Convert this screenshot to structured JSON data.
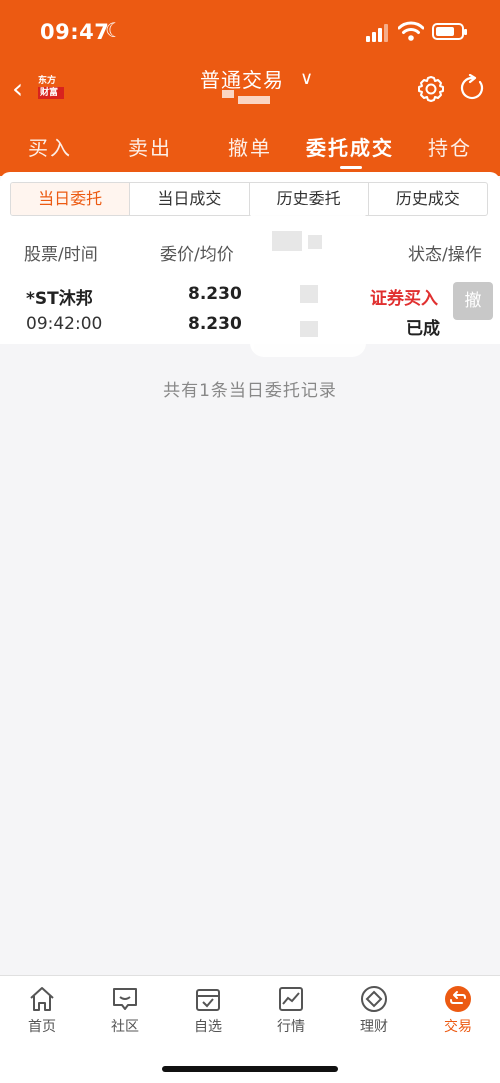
{
  "status_bar": {
    "time": "09:47",
    "moon": "☾"
  },
  "navbar": {
    "logo_line1": "东方",
    "logo_line2": "财富",
    "title": "普通交易",
    "caret": "∨"
  },
  "tabs": [
    {
      "label": "买入"
    },
    {
      "label": "卖出"
    },
    {
      "label": "撤单"
    },
    {
      "label": "委托成交"
    },
    {
      "label": "持仓"
    }
  ],
  "segments": [
    {
      "label": "当日委托"
    },
    {
      "label": "当日成交"
    },
    {
      "label": "历史委托"
    },
    {
      "label": "历史成交"
    }
  ],
  "table": {
    "headers": {
      "stock_time": "股票/时间",
      "price": "委价/均价",
      "status_action": "状态/操作"
    },
    "rows": [
      {
        "name": "*ST沐邦",
        "time": "09:42:00",
        "order_price": "8.230",
        "avg_price": "8.230",
        "type": "证券买入",
        "status": "已成",
        "cancel_label": "撤"
      }
    ]
  },
  "summary": "共有1条当日委托记录",
  "bottom_nav": [
    {
      "label": "首页",
      "icon": "home-icon"
    },
    {
      "label": "社区",
      "icon": "community-icon"
    },
    {
      "label": "自选",
      "icon": "watchlist-icon"
    },
    {
      "label": "行情",
      "icon": "market-icon"
    },
    {
      "label": "理财",
      "icon": "wealth-icon"
    },
    {
      "label": "交易",
      "icon": "trade-icon"
    }
  ],
  "colors": {
    "brand": "#ec5a12",
    "sell_red": "#e03030"
  }
}
